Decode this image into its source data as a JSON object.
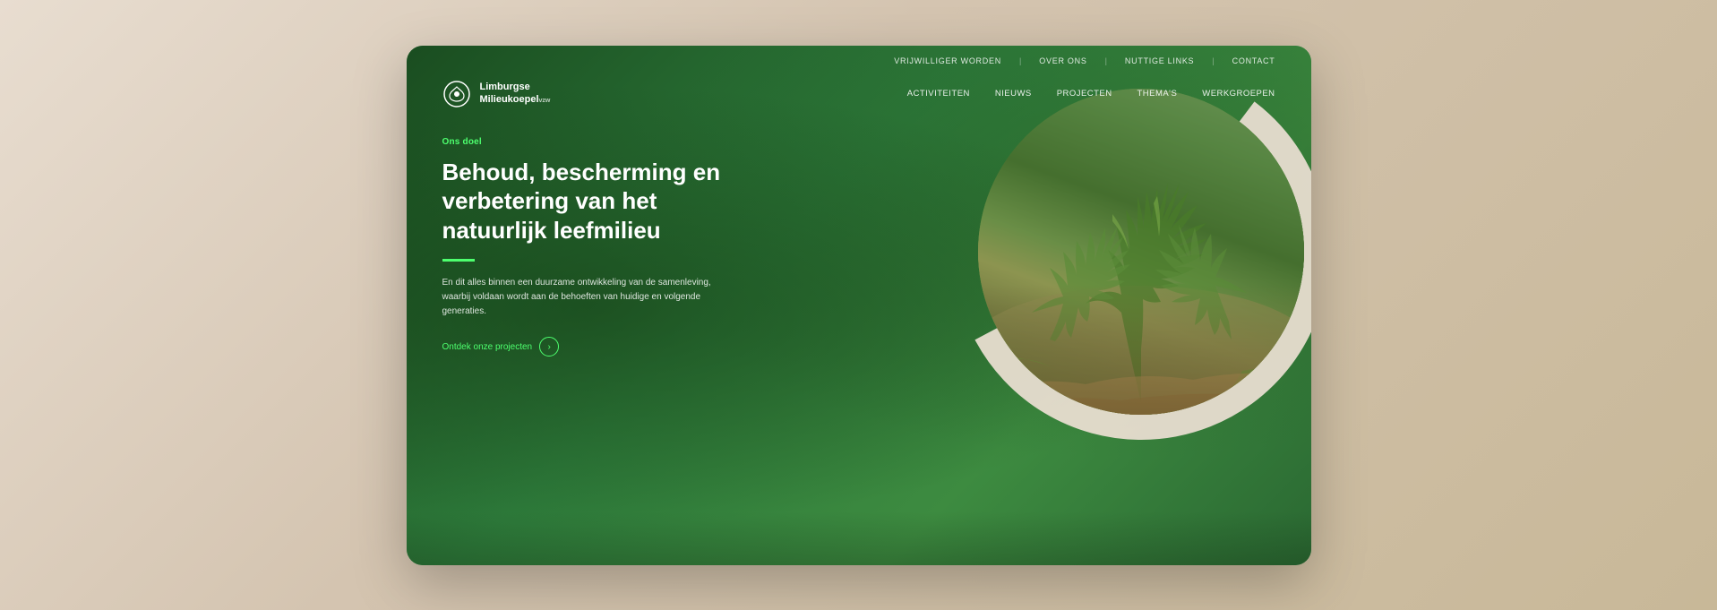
{
  "browser": {
    "title": "Limburgse Milieukoepel vzw"
  },
  "top_nav": {
    "items": [
      {
        "label": "VRIJWILLIGER WORDEN",
        "key": "vrijwilliger"
      },
      {
        "label": "OVER ONS",
        "key": "over-ons"
      },
      {
        "label": "NUTTIGE LINKS",
        "key": "nuttige-links"
      },
      {
        "label": "CONTACT",
        "key": "contact"
      }
    ]
  },
  "main_nav": {
    "logo": {
      "line1": "Limburgse",
      "line2": "Milieukoepel",
      "suffix": "vzw"
    },
    "items": [
      {
        "label": "ACTIVITEITEN",
        "key": "activiteiten"
      },
      {
        "label": "NIEUWS",
        "key": "nieuws"
      },
      {
        "label": "PROJECTEN",
        "key": "projecten"
      },
      {
        "label": "THEMA'S",
        "key": "themas"
      },
      {
        "label": "WERKGROEPEN",
        "key": "werkgroepen"
      }
    ]
  },
  "hero": {
    "ons_doel": "Ons doel",
    "title": "Behoud, bescherming en verbetering van het natuurlijk leefmilieu",
    "description": "En dit alles binnen een duurzame ontwikkeling van de samenleving, waarbij voldaan wordt aan de behoeften van huidige en volgende generaties.",
    "cta_text": "Ontdek onze projecten",
    "cta_icon": "→"
  },
  "colors": {
    "green_dark": "#2d7a3a",
    "green_accent": "#4dff6e",
    "beige": "#e8ddd0",
    "white": "#ffffff"
  }
}
